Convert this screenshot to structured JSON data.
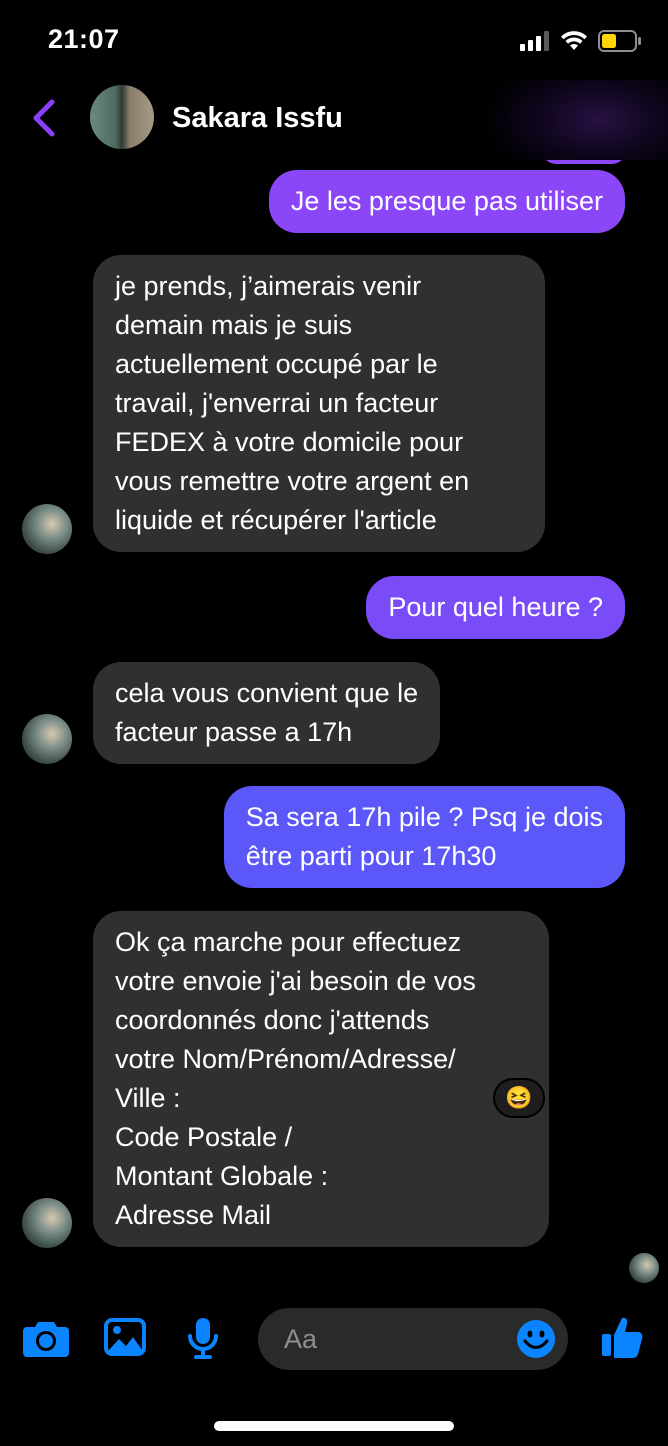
{
  "status_bar": {
    "time": "21:07"
  },
  "header": {
    "contact_name": "Sakara Issfu"
  },
  "messages": [
    {
      "direction": "outgoing",
      "text": "Je les presque pas utiliser"
    },
    {
      "direction": "incoming",
      "text": "je prends, j’aimerais venir\ndemain mais je suis\nactuellement occupé par le\ntravail, j'enverrai un facteur\nFEDEX à votre domicile pour\nvous remettre votre argent en\nliquide et récupérer l'article"
    },
    {
      "direction": "outgoing",
      "text": "Pour quel heure ?"
    },
    {
      "direction": "incoming",
      "text": "cela vous convient que le\nfacteur passe a 17h"
    },
    {
      "direction": "outgoing",
      "text": "Sa sera 17h pile ? Psq je dois\nêtre parti pour 17h30"
    },
    {
      "direction": "incoming",
      "text": "Ok ça marche pour effectuez\nvotre envoie j'ai besoin de vos\ncoordonnés donc j'attends\nvotre Nom/Prénom/Adresse/\nVille :\nCode Postale /\nMontant Globale :\nAdresse Mail"
    }
  ],
  "reaction": {
    "emoji": "😆"
  },
  "composer": {
    "placeholder": "Aa"
  },
  "colors": {
    "accent": "#8a3ffc",
    "outgoing_purple": "#8b46f7",
    "outgoing_blue": "#5b57f8",
    "incoming_bubble": "#303030",
    "icon_blue": "#0a84ff"
  }
}
